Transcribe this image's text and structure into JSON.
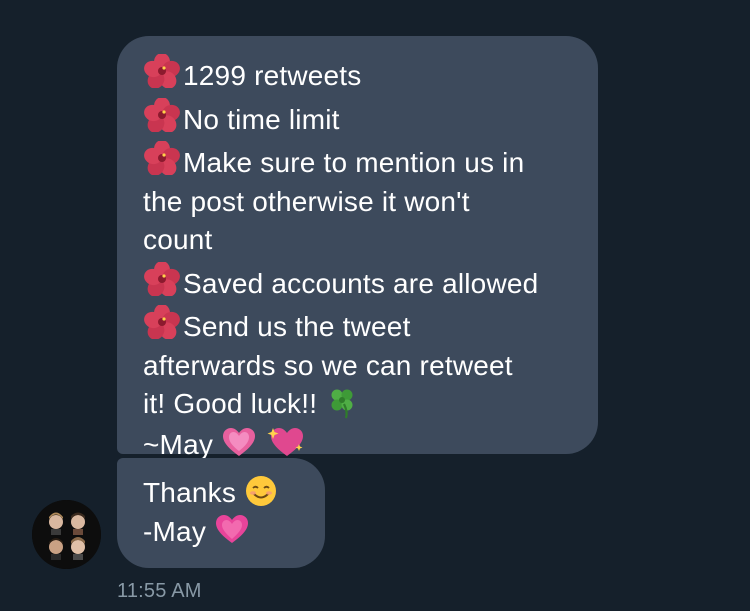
{
  "messages": [
    {
      "lines": [
        "1299 retweets",
        "No time limit",
        "Make sure to mention us in",
        "the post otherwise it won't",
        "count",
        "Saved accounts are allowed",
        "Send us the tweet",
        "afterwards so we can retweet",
        "it! Good luck!!",
        "~May"
      ]
    },
    {
      "lines": [
        "Thanks",
        "-May"
      ]
    }
  ],
  "timestamp": "11:55 AM",
  "icons": {
    "bullet": "hibiscus-icon",
    "clover": "four-leaf-clover-icon",
    "heart_beating": "beating-heart-icon",
    "heart_sparkling": "sparkling-heart-icon",
    "smile": "smiling-face-icon",
    "heart_growing": "growing-heart-icon"
  },
  "colors": {
    "background": "#15202b",
    "bubble": "#3d4a5c",
    "text": "#ffffff",
    "timestamp": "#8899a6"
  }
}
